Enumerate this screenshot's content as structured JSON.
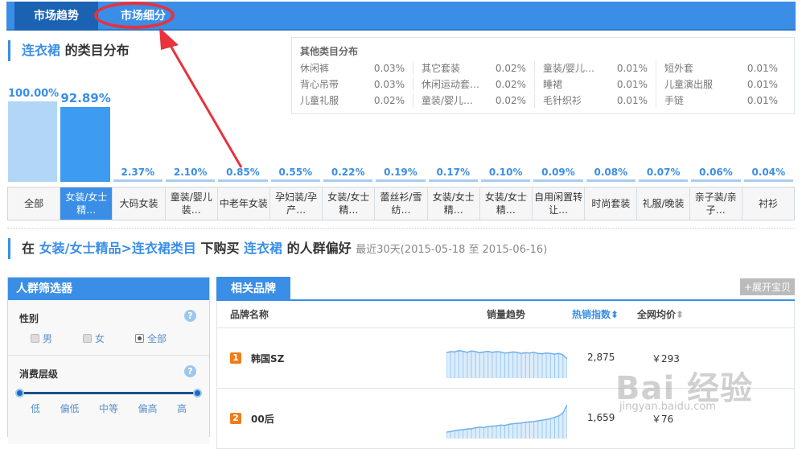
{
  "tabs": [
    {
      "label": "市场趋势"
    },
    {
      "label": "市场细分"
    }
  ],
  "category_section": {
    "prefix": "连衣裙",
    "suffix": "的类目分布"
  },
  "other_dist": {
    "title": "其他类目分布",
    "items": [
      {
        "name": "休闲裤",
        "pct": "0.03%"
      },
      {
        "name": "其它套装",
        "pct": "0.02%"
      },
      {
        "name": "童装/婴儿…",
        "pct": "0.01%"
      },
      {
        "name": "短外套",
        "pct": "0.01%"
      },
      {
        "name": "背心吊带",
        "pct": "0.03%"
      },
      {
        "name": "休闲运动套…",
        "pct": "0.02%"
      },
      {
        "name": "睡裙",
        "pct": "0.01%"
      },
      {
        "name": "儿童演出服",
        "pct": "0.01%"
      },
      {
        "name": "儿童礼服",
        "pct": "0.02%"
      },
      {
        "name": "童装/婴儿…",
        "pct": "0.02%"
      },
      {
        "name": "毛针织衫",
        "pct": "0.01%"
      },
      {
        "name": "手链",
        "pct": "0.01%"
      }
    ]
  },
  "chart_data": {
    "type": "bar",
    "categories": [
      "全部",
      "女装/女士\n精…",
      "大码女装",
      "童装/婴儿\n装…",
      "中老年女装",
      "孕妇装/孕\n产…",
      "女装/女士\n精…",
      "蕾丝衫/雪\n纺…",
      "女装/女士\n精…",
      "女装/女士\n精…",
      "自用闲置转\n让…",
      "时尚套装",
      "礼服/晚装",
      "亲子装/亲\n子…",
      "衬衫"
    ],
    "values": [
      100.0,
      92.89,
      2.37,
      2.1,
      0.85,
      0.55,
      0.22,
      0.19,
      0.17,
      0.1,
      0.09,
      0.08,
      0.07,
      0.06,
      0.04
    ],
    "labels": [
      "100.00%",
      "92.89%",
      "2.37%",
      "2.10%",
      "0.85%",
      "0.55%",
      "0.22%",
      "0.19%",
      "0.17%",
      "0.10%",
      "0.09%",
      "0.08%",
      "0.07%",
      "0.06%",
      "0.04%"
    ],
    "selected_index": 1,
    "ylim": [
      0,
      100
    ]
  },
  "crowd_section": {
    "pre": "在",
    "path": "女装/女士精品>连衣裙类目",
    "mid": "下购买",
    "keyword": "连衣裙",
    "post": "的人群偏好",
    "range": "最近30天(2015-05-18 至 2015-06-16)"
  },
  "filter": {
    "title": "人群筛选器",
    "gender_label": "性别",
    "help": "?",
    "genders": [
      {
        "label": "男",
        "checked": false
      },
      {
        "label": "女",
        "checked": false
      },
      {
        "label": "全部",
        "checked": true
      }
    ],
    "level_label": "消费层级",
    "levels": [
      "低",
      "偏低",
      "中等",
      "偏高",
      "高"
    ]
  },
  "brands": {
    "tab": "相关品牌",
    "expand": "+展开宝贝",
    "cols": {
      "name": "品牌名称",
      "trend": "销量趋势",
      "hot": "热销指数",
      "price": "全网均价"
    },
    "rows": [
      {
        "rank": "1",
        "name": "韩国SZ",
        "hot": "2,875",
        "price": "￥293",
        "spark": [
          0.72,
          0.75,
          0.74,
          0.78,
          0.76,
          0.73,
          0.77,
          0.75,
          0.72,
          0.74,
          0.76,
          0.73,
          0.75,
          0.74,
          0.71,
          0.72,
          0.74,
          0.73,
          0.7,
          0.72,
          0.71,
          0.73,
          0.7,
          0.69,
          0.71,
          0.7,
          0.68,
          0.7,
          0.66,
          0.55
        ]
      },
      {
        "rank": "2",
        "name": "00后",
        "hot": "1,659",
        "price": "￥76",
        "spark": [
          0.18,
          0.2,
          0.22,
          0.24,
          0.25,
          0.27,
          0.28,
          0.3,
          0.32,
          0.31,
          0.34,
          0.35,
          0.36,
          0.38,
          0.37,
          0.4,
          0.42,
          0.43,
          0.44,
          0.46,
          0.47,
          0.48,
          0.5,
          0.52,
          0.54,
          0.56,
          0.6,
          0.64,
          0.72,
          0.95
        ]
      }
    ]
  },
  "colors": {
    "accent": "#3a8ee6",
    "highlight": "#e8323c",
    "rank": "#f07c1a"
  },
  "watermark": {
    "main": "Bai 经验",
    "sub": "jingyan.baidu.com"
  }
}
